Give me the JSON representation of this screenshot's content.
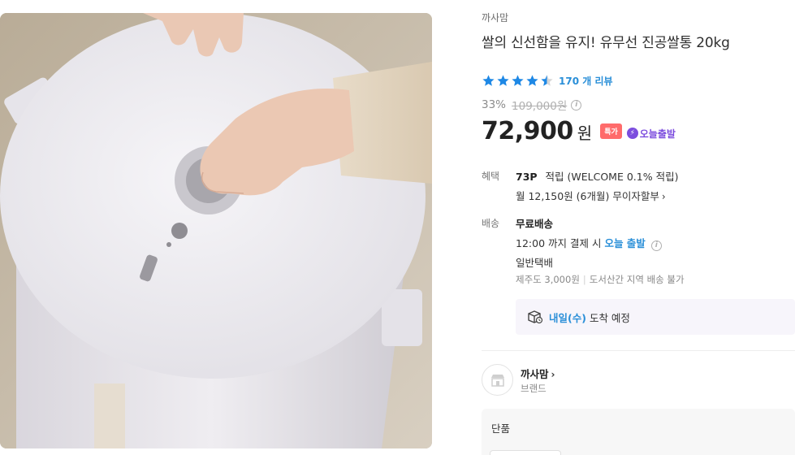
{
  "product": {
    "brand": "까사맘",
    "title": "쌀의 신선함을 유지! 유무선 진공쌀통 20kg",
    "rating": 4.5,
    "review_count": "170 개 리뷰",
    "discount_rate": "33%",
    "original_price": "109,000원",
    "price": "72,900",
    "currency": "원",
    "special_badge": "특가",
    "today_ship_badge": "오늘출발"
  },
  "benefits": {
    "label": "혜택",
    "points": "73P",
    "points_text": "적립 (WELCOME 0.1% 적립)",
    "installment": "월 12,150원 (6개월) 무이자할부"
  },
  "shipping": {
    "label": "배송",
    "fee": "무료배송",
    "cutoff_prefix": "12:00 까지 결제 시",
    "cutoff_highlight": "오늘 출발",
    "method": "일반택배",
    "jeju": "제주도 3,000원",
    "remote": "도서산간 지역 배송 불가",
    "arrival_day": "내일(수)",
    "arrival_text": "도착 예정"
  },
  "brand_card": {
    "name": "까사맘",
    "subtitle": "브랜드"
  },
  "options": {
    "label": "단품"
  },
  "colors": {
    "accent_blue": "#2a8fd8",
    "special_red": "#ff6b6b",
    "today_purple": "#7c4dde",
    "star_blue": "#1e88e5"
  }
}
